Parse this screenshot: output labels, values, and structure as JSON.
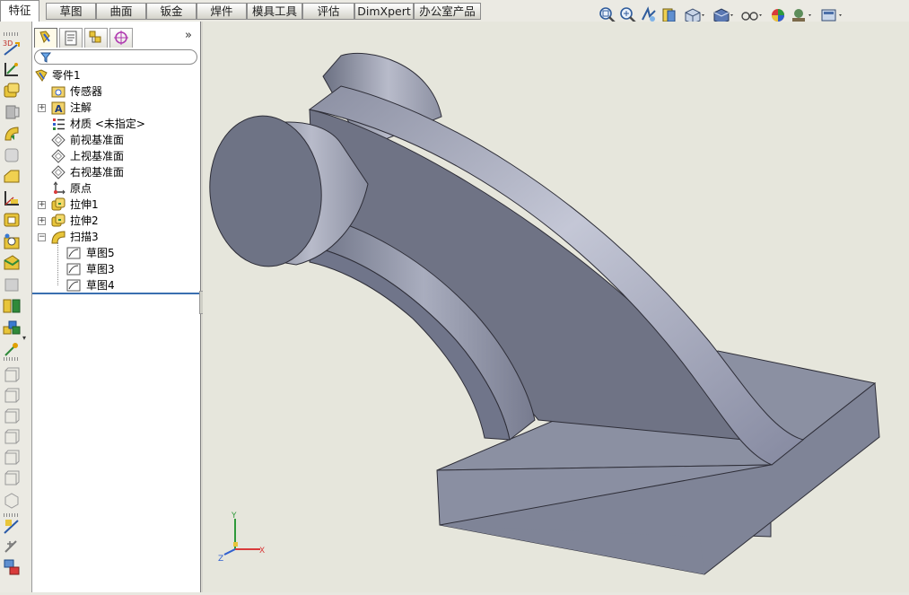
{
  "tabs": [
    {
      "label": "特征",
      "active": true
    },
    {
      "label": "草图"
    },
    {
      "label": "曲面"
    },
    {
      "label": "钣金"
    },
    {
      "label": "焊件"
    },
    {
      "label": "模具工具"
    },
    {
      "label": "评估"
    },
    {
      "label": "DimXpert"
    },
    {
      "label": "办公室产品"
    }
  ],
  "view_toolbar": [
    {
      "icon": "zoom-to-fit-icon"
    },
    {
      "icon": "zoom-to-area-icon"
    },
    {
      "icon": "previous-view-icon"
    },
    {
      "icon": "section-view-icon"
    },
    {
      "icon": "view-orientation-icon"
    },
    {
      "icon": "display-style-icon"
    },
    {
      "icon": "hide-show-items-icon"
    },
    {
      "icon": "edit-appearance-icon"
    },
    {
      "icon": "apply-scene-icon"
    },
    {
      "icon": "view-settings-icon"
    }
  ],
  "feature_manager": {
    "panel_tabs": [
      "featuremanager-tree-icon",
      "propertymanager-icon",
      "configurationmanager-icon",
      "dimxpertmanager-icon"
    ],
    "collapse_glyph": "»",
    "tree": [
      {
        "label": "零件1",
        "icon": "part-icon"
      },
      {
        "label": "传感器",
        "icon": "sensor-folder-icon"
      },
      {
        "label": "注解",
        "icon": "annotations-icon",
        "expand": "+"
      },
      {
        "label": "材质 <未指定>",
        "icon": "material-icon"
      },
      {
        "label": "前视基准面",
        "icon": "plane-icon"
      },
      {
        "label": "上视基准面",
        "icon": "plane-icon"
      },
      {
        "label": "右视基准面",
        "icon": "plane-icon"
      },
      {
        "label": "原点",
        "icon": "origin-icon"
      },
      {
        "label": "拉伸1",
        "icon": "extrude-icon",
        "expand": "+"
      },
      {
        "label": "拉伸2",
        "icon": "extrude-icon",
        "expand": "+"
      },
      {
        "label": "扫描3",
        "icon": "sweep-icon",
        "expand": "−"
      },
      {
        "label": "草图5",
        "icon": "sketch-icon"
      },
      {
        "label": "草图3",
        "icon": "sketch-icon"
      },
      {
        "label": "草图4",
        "icon": "sketch-icon"
      }
    ]
  },
  "triad": {
    "x": "X",
    "y": "Y",
    "z": "Z"
  },
  "colors": {
    "accent": "#3a6fb0",
    "model": "#7f8496",
    "background": "#e6e6dc"
  }
}
